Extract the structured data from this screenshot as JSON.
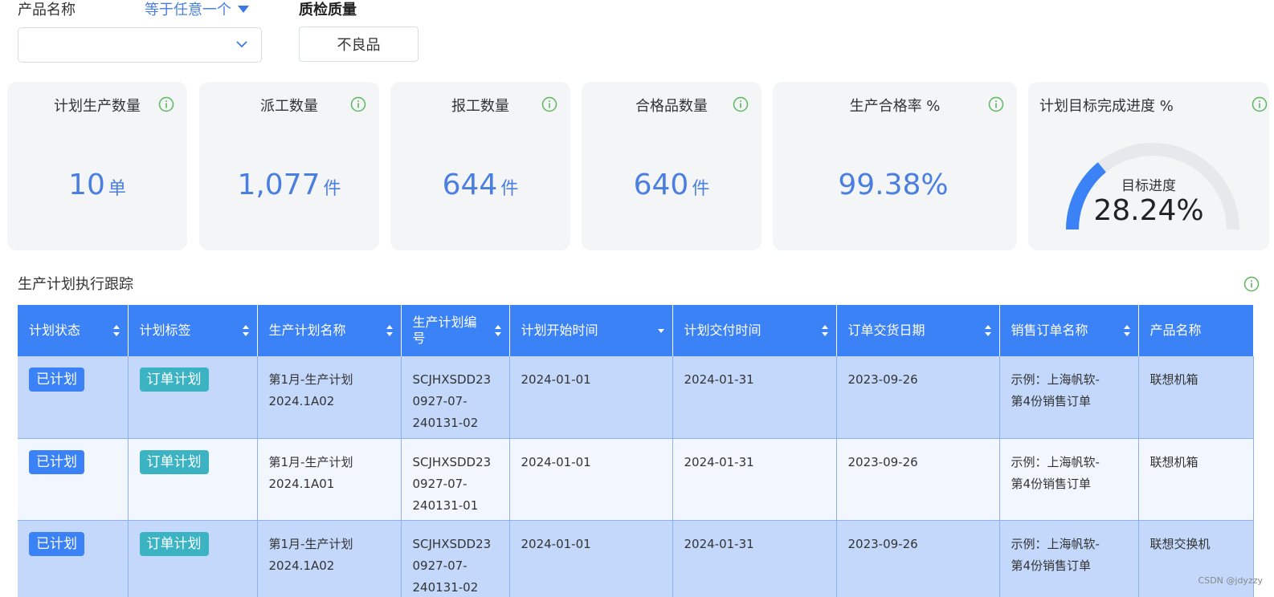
{
  "filters": {
    "product_label": "产品名称",
    "operator_label": "等于任意一个",
    "quality_label": "质检质量",
    "quality_value": "不良品",
    "product_select_value": ""
  },
  "cards": [
    {
      "title": "计划生产数量",
      "value": "10",
      "unit": "单"
    },
    {
      "title": "派工数量",
      "value": "1,077",
      "unit": "件"
    },
    {
      "title": "报工数量",
      "value": "644",
      "unit": "件"
    },
    {
      "title": "合格品数量",
      "value": "640",
      "unit": "件"
    },
    {
      "title": "生产合格率 %",
      "value": "99.38%",
      "unit": ""
    },
    {
      "title": "计划目标完成进度 %",
      "gauge_label": "目标进度",
      "value": "28.24%",
      "progress": 0.2824
    }
  ],
  "section": {
    "title": "生产计划执行跟踪"
  },
  "table": {
    "headers": [
      "计划状态",
      "计划标签",
      "生产计划名称",
      "生产计划编号",
      "计划开始时间",
      "计划交付时间",
      "订单交货日期",
      "销售订单名称",
      "产品名称"
    ],
    "rows": [
      {
        "status": "已计划",
        "label": "订单计划",
        "name_line1": "第1月-生产计划",
        "name_line2": "2024.1A02",
        "code_line1": "SCJHXSDD23",
        "code_line2": "0927-07-",
        "code_line3": "240131-02",
        "start": "2024-01-01",
        "delivery": "2024-01-31",
        "order_date": "2023-09-26",
        "so_line1": "示例：上海帆软-",
        "so_line2": "第4份销售订单",
        "product": "联想机箱"
      },
      {
        "status": "已计划",
        "label": "订单计划",
        "name_line1": "第1月-生产计划",
        "name_line2": "2024.1A01",
        "code_line1": "SCJHXSDD23",
        "code_line2": "0927-07-",
        "code_line3": "240131-01",
        "start": "2024-01-01",
        "delivery": "2024-01-31",
        "order_date": "2023-09-26",
        "so_line1": "示例：上海帆软-",
        "so_line2": "第4份销售订单",
        "product": "联想机箱"
      },
      {
        "status": "已计划",
        "label": "订单计划",
        "name_line1": "第1月-生产计划",
        "name_line2": "2024.1A02",
        "code_line1": "SCJHXSDD23",
        "code_line2": "0927-07-",
        "code_line3": "240131-02",
        "start": "2024-01-01",
        "delivery": "2024-01-31",
        "order_date": "2023-09-26",
        "so_line1": "示例：上海帆软-",
        "so_line2": "第4份销售订单",
        "product": "联想交换机"
      }
    ]
  },
  "watermark": "CSDN @jdyzzy",
  "colors": {
    "accent": "#3b82f6",
    "tag_label": "#3bb3c3",
    "row_highlight": "#c3d8fb",
    "value_blue": "#4a7fe0"
  }
}
